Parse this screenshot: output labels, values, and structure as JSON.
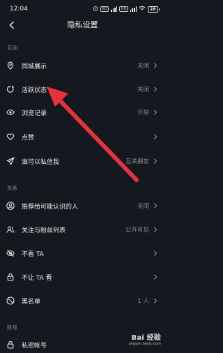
{
  "status_bar": {
    "time": "12:04",
    "net_badge_1": "HD",
    "net_badge_2": "HD",
    "battery": "28"
  },
  "header": {
    "title": "隐私设置"
  },
  "sections": [
    {
      "title": "互动",
      "items": [
        {
          "label": "同城展示",
          "value": "关闭",
          "icon": "location-pin-icon"
        },
        {
          "label": "活跃状态",
          "value": "关闭",
          "icon": "activity-status-icon"
        },
        {
          "label": "浏览记录",
          "value": "开启",
          "icon": "eye-icon"
        },
        {
          "label": "点赞",
          "value": "",
          "icon": "heart-icon"
        },
        {
          "label": "谁可以私信我",
          "value": "互关朋友",
          "icon": "paper-plane-icon"
        }
      ]
    },
    {
      "title": "关系",
      "items": [
        {
          "label": "推荐给可能认识的人",
          "value": "关闭",
          "icon": "person-circle-icon"
        },
        {
          "label": "关注与粉丝列表",
          "value": "公开可见",
          "icon": "people-icon"
        },
        {
          "label": "不看 TA",
          "value": "",
          "icon": "eye-off-icon"
        },
        {
          "label": "不让 TA 看",
          "value": "",
          "icon": "lock-icon"
        },
        {
          "label": "黑名单",
          "value": "1 人",
          "icon": "block-icon"
        }
      ]
    },
    {
      "title": "账号",
      "items": [
        {
          "label": "私密帐号",
          "value": "",
          "icon": "lock-closed-icon"
        }
      ]
    }
  ],
  "watermark": {
    "main": "Bai 经验",
    "sub": "jingyan.baidu.com"
  },
  "colors": {
    "background": "#16181f",
    "arrow": "#e5333d",
    "muted_text": "#8c8d92"
  }
}
